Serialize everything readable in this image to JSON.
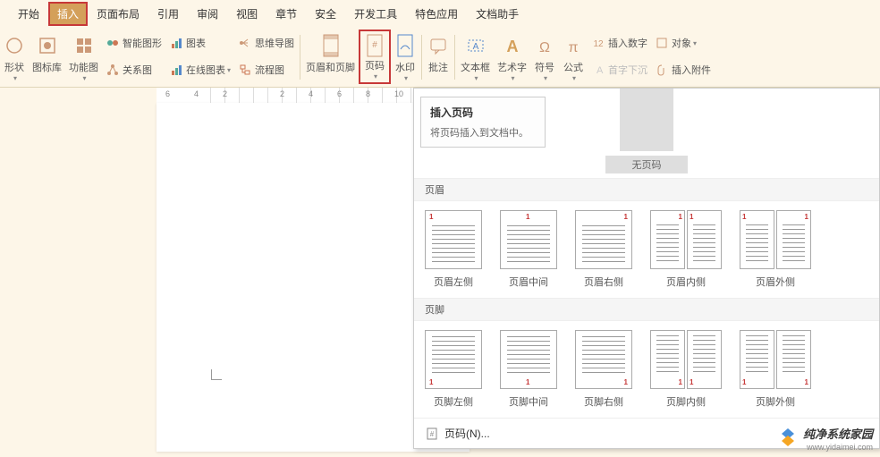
{
  "tabs": {
    "start": "开始",
    "insert": "插入",
    "layout": "页面布局",
    "reference": "引用",
    "review": "审阅",
    "view": "视图",
    "chapter": "章节",
    "security": "安全",
    "devtools": "开发工具",
    "special": "特色应用",
    "assistant": "文档助手"
  },
  "ribbon": {
    "shape": "形状",
    "iconlib": "图标库",
    "function_chart": "功能图",
    "smart_graphic": "智能图形",
    "chart": "图表",
    "relation": "关系图",
    "mindmap": "思维导图",
    "online_chart": "在线图表",
    "flowchart": "流程图",
    "header_footer": "页眉和页脚",
    "page_number": "页码",
    "watermark": "水印",
    "comment": "批注",
    "textbox": "文本框",
    "wordart": "艺术字",
    "symbol": "符号",
    "formula": "公式",
    "insert_number": "插入数字",
    "dropcap": "首字下沉",
    "object": "对象",
    "attachment": "插入附件"
  },
  "ruler": {
    "m6": "6",
    "m4": "4",
    "m2": "2",
    "p2": "2",
    "p4": "4",
    "p6": "6",
    "p8": "8",
    "p10": "10"
  },
  "tooltip": {
    "title": "插入页码",
    "desc": "将页码插入到文档中。"
  },
  "dropdown": {
    "no_page": "无页码",
    "header_section": "页眉",
    "footer_section": "页脚",
    "header_left": "页眉左侧",
    "header_center": "页眉中间",
    "header_right": "页眉右侧",
    "header_inside": "页眉内侧",
    "header_outside": "页眉外侧",
    "footer_left": "页脚左侧",
    "footer_center": "页脚中间",
    "footer_right": "页脚右侧",
    "footer_inside": "页脚内侧",
    "footer_outside": "页脚外侧",
    "page_number_n": "页码(N)...",
    "num": "1"
  },
  "watermark": {
    "text": "纯净系统家园",
    "url": "www.yidaimei.com"
  }
}
